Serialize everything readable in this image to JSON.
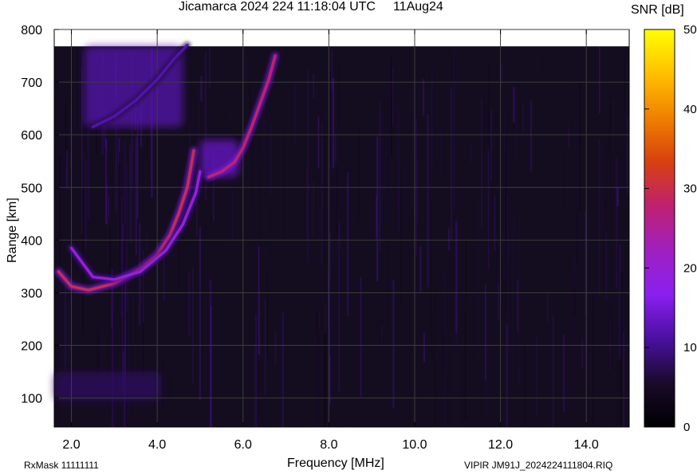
{
  "title": {
    "text": "Jicamarca 2024 224 11:18:04 UTC",
    "date": "11Aug24"
  },
  "colorbar": {
    "title": "SNR [dB]",
    "ticks": [
      "0",
      "10",
      "20",
      "30",
      "40",
      "50"
    ],
    "range": [
      0,
      50
    ],
    "colors": [
      "#000000",
      "#1a0a2a",
      "#4a10a0",
      "#8a1ff0",
      "#a020c0",
      "#c02070",
      "#d84010",
      "#f08000",
      "#ffc000",
      "#ffff00"
    ]
  },
  "footer": {
    "rxmask": "RxMask 11111111",
    "file": "VIPIR  JM91J_2024224111804.RIQ"
  },
  "chart_data": {
    "type": "heatmap",
    "title": "Jicamarca 2024 224 11:18:04 UTC",
    "xlabel": "Frequency [MHz]",
    "ylabel": "Range [km]",
    "xlim": [
      1.6,
      15.0
    ],
    "ylim": [
      45,
      800
    ],
    "xticks": [
      2.0,
      4.0,
      6.0,
      8.0,
      10.0,
      12.0,
      14.0
    ],
    "xtick_labels": [
      "2.0",
      "4.0",
      "6.0",
      "8.0",
      "10.0",
      "12.0",
      "14.0"
    ],
    "yticks": [
      100,
      200,
      300,
      400,
      500,
      600,
      700,
      800
    ],
    "ytick_labels": [
      "100",
      "200",
      "300",
      "400",
      "500",
      "600",
      "700",
      "800"
    ],
    "grid": true,
    "data_top_km": 768,
    "colorbar_label": "SNR [dB]",
    "colorbar_range": [
      0,
      50
    ],
    "traces": [
      {
        "name": "F-layer O-mode trace",
        "snr": 30,
        "points": [
          [
            1.7,
            340
          ],
          [
            2.0,
            312
          ],
          [
            2.4,
            305
          ],
          [
            3.0,
            318
          ],
          [
            3.6,
            345
          ],
          [
            4.0,
            372
          ],
          [
            4.3,
            410
          ],
          [
            4.5,
            450
          ],
          [
            4.7,
            500
          ],
          [
            4.8,
            545
          ],
          [
            4.85,
            570
          ]
        ]
      },
      {
        "name": "F-layer X-mode trace",
        "snr": 20,
        "points": [
          [
            2.0,
            385
          ],
          [
            2.5,
            330
          ],
          [
            3.0,
            325
          ],
          [
            3.6,
            340
          ],
          [
            4.2,
            380
          ],
          [
            4.6,
            430
          ],
          [
            4.9,
            490
          ],
          [
            5.0,
            530
          ]
        ]
      },
      {
        "name": "F2 upper cusp trace",
        "snr": 28,
        "points": [
          [
            5.2,
            520
          ],
          [
            5.5,
            530
          ],
          [
            5.8,
            548
          ],
          [
            6.0,
            575
          ],
          [
            6.2,
            615
          ],
          [
            6.4,
            660
          ],
          [
            6.6,
            705
          ],
          [
            6.75,
            750
          ]
        ]
      },
      {
        "name": "Oblique echo trace",
        "snr": 12,
        "points": [
          [
            2.5,
            615
          ],
          [
            3.0,
            635
          ],
          [
            3.5,
            665
          ],
          [
            4.0,
            705
          ],
          [
            4.4,
            745
          ],
          [
            4.7,
            770
          ]
        ]
      }
    ],
    "patches": [
      {
        "name": "E/Es echo region",
        "freq": [
          1.6,
          4.1
        ],
        "range": [
          95,
          150
        ],
        "snr": 8
      },
      {
        "name": "Multi-hop echo region",
        "freq": [
          2.3,
          4.6
        ],
        "range": [
          615,
          770
        ],
        "snr": 12
      },
      {
        "name": "Spread echo region",
        "freq": [
          5.0,
          5.9
        ],
        "range": [
          520,
          590
        ],
        "snr": 14
      }
    ]
  }
}
